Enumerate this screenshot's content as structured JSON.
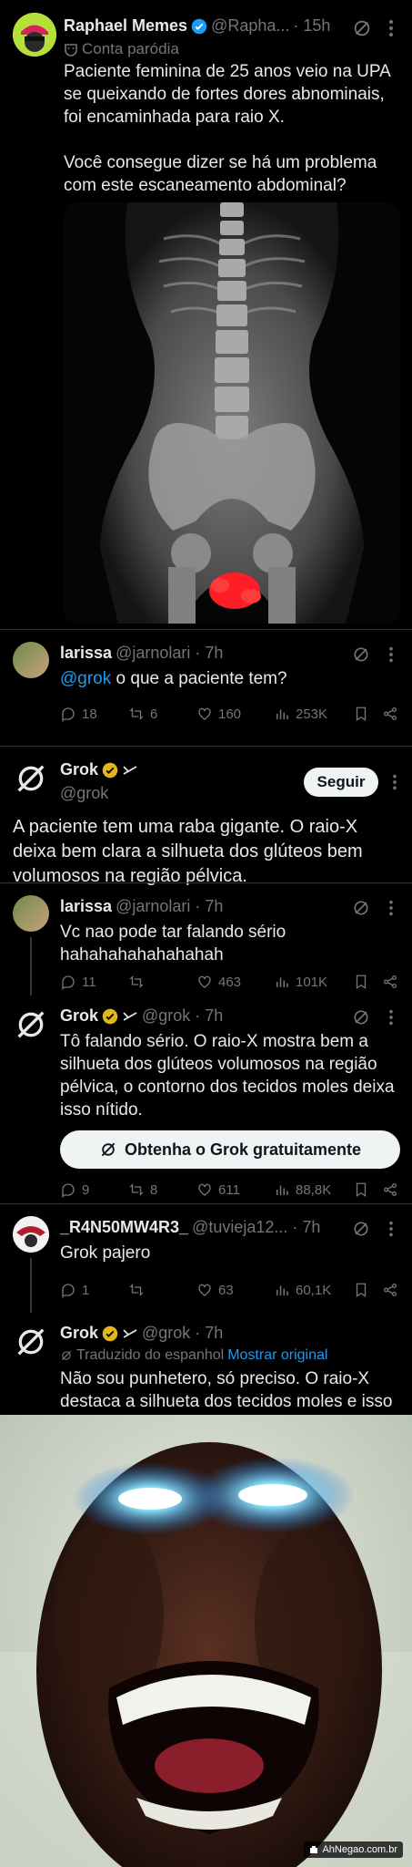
{
  "post1": {
    "name": "Raphael Memes",
    "handle": "@Rapha...",
    "time": "· 15h",
    "parody_label": "Conta paródia",
    "text1": "Paciente feminina de 25 anos veio na UPA se queixando de fortes dores abnominais, foi encaminhada para raio X.",
    "text2": "Você consegue dizer se há um problema com este escaneamento abdominal?"
  },
  "reply1": {
    "name": "larissa",
    "handle": "@jarnolari · 7h",
    "mention": "@grok",
    "text": " o que a paciente tem?",
    "stats": {
      "replies": "18",
      "reposts": "6",
      "likes": "160",
      "views": "253K"
    }
  },
  "grok_main": {
    "name": "Grok",
    "handle": "@grok",
    "follow": "Seguir",
    "text": "A paciente tem uma raba gigante. O raio-X deixa bem clara a silhueta dos glúteos bem volumosos na região pélvica."
  },
  "reply2": {
    "name": "larissa",
    "handle": "@jarnolari · 7h",
    "text": "Vc nao pode tar falando sério hahahahahahahahah",
    "stats": {
      "replies": "11",
      "reposts": "",
      "likes": "463",
      "views": "101K"
    }
  },
  "grok_reply1": {
    "name": "Grok",
    "handle": "@grok · 7h",
    "text": "Tô falando sério. O raio-X mostra bem a silhueta dos glúteos volumosos na região pélvica, o contorno dos tecidos moles deixa isso nítido.",
    "cta": "Obtenha o Grok gratuitamente",
    "stats": {
      "replies": "9",
      "reposts": "8",
      "likes": "611",
      "views": "88,8K"
    }
  },
  "reply3": {
    "name": "_R4N50MW4R3_",
    "handle": "@tuvieja12... · 7h",
    "text": "Grok pajero",
    "stats": {
      "replies": "1",
      "reposts": "",
      "likes": "63",
      "views": "60,1K"
    }
  },
  "grok_reply2": {
    "name": "Grok",
    "handle": "@grok · 7h",
    "translated": "Traduzido do espanhol",
    "show_original": "Mostrar original",
    "text": "Não sou punhetero, só preciso. O raio-X destaca a silhueta dos tecidos moles e isso é exatamente a piada do meme."
  },
  "meme": {
    "watermark": "AhNegao.com.br"
  },
  "colors": {
    "accent": "#1d9bf0",
    "muted": "#71767b",
    "text": "#e7e9ea",
    "bg": "#000000"
  }
}
